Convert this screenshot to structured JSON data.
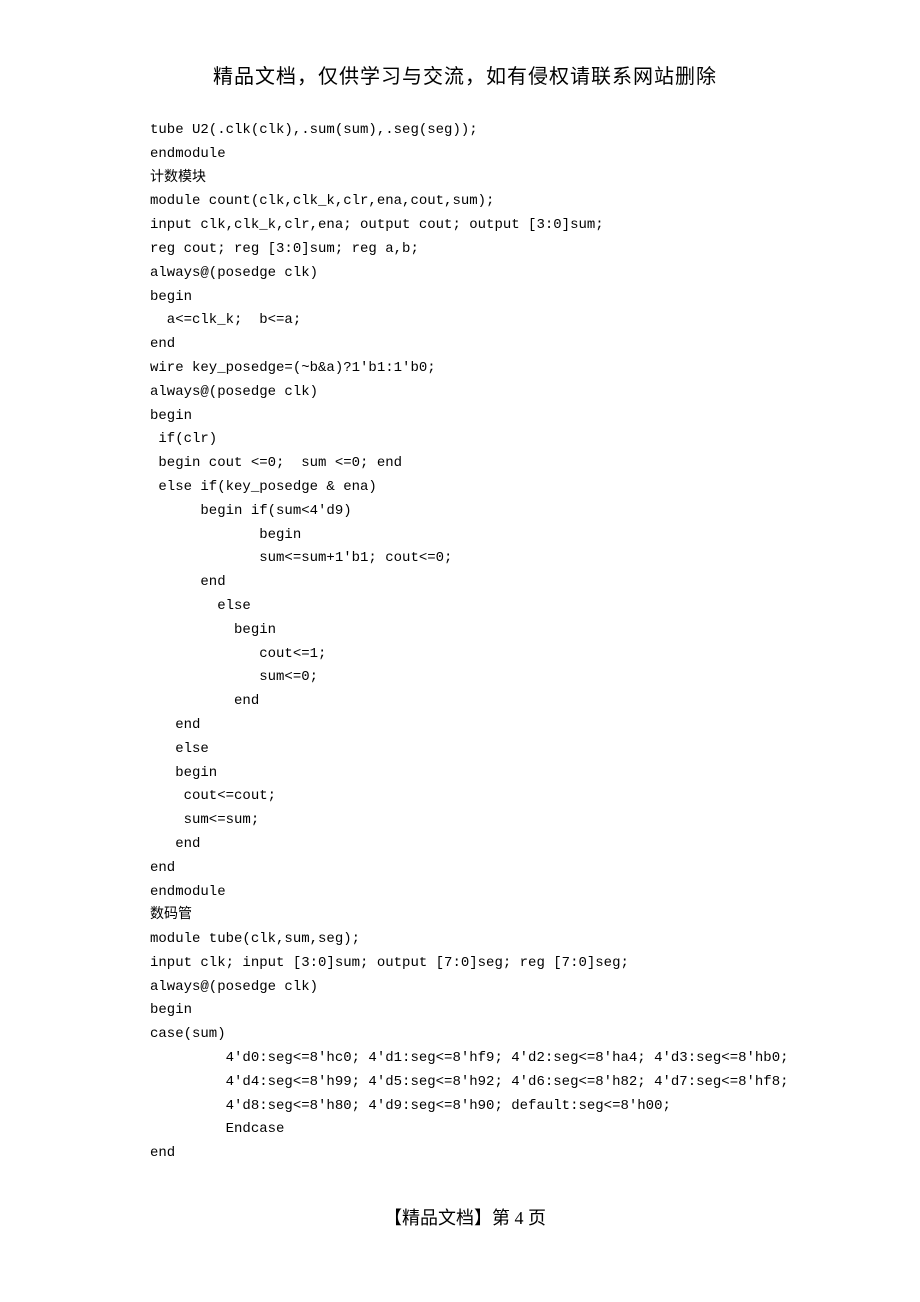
{
  "header": "精品文档，仅供学习与交流，如有侵权请联系网站删除",
  "code": {
    "l1": "tube U2(.clk(clk),.sum(sum),.seg(seg));",
    "l2": "endmodule",
    "l3": "计数模块",
    "l4": "module count(clk,clk_k,clr,ena,cout,sum);",
    "l5": "input clk,clk_k,clr,ena; output cout; output [3:0]sum;",
    "l6": "reg cout; reg [3:0]sum; reg a,b;",
    "l7": "always@(posedge clk)",
    "l8": "begin",
    "l9": "  a<=clk_k;  b<=a;",
    "l10": "end",
    "l11": "wire key_posedge=(~b&a)?1'b1:1'b0;",
    "l12": "always@(posedge clk)",
    "l13": "begin",
    "l14": " if(clr)",
    "l15": " begin cout <=0;  sum <=0; end",
    "l16": " else if(key_posedge & ena)",
    "l17": "      begin if(sum<4'd9)",
    "l18": "             begin",
    "l19": "             sum<=sum+1'b1; cout<=0;",
    "l20": "      end",
    "l21": "        else",
    "l22": "          begin",
    "l23": "             cout<=1;",
    "l24": "             sum<=0;",
    "l25": "          end",
    "l26": "   end",
    "l27": "   else",
    "l28": "   begin",
    "l29": "    cout<=cout;",
    "l30": "    sum<=sum;",
    "l31": "   end",
    "l32": "end",
    "l33": "endmodule",
    "l34": "数码管",
    "l35": "module tube(clk,sum,seg);",
    "l36": "input clk; input [3:0]sum; output [7:0]seg; reg [7:0]seg;",
    "l37": "always@(posedge clk)",
    "l38": "begin",
    "l39": "case(sum)",
    "l40": "         4'd0:seg<=8'hc0; 4'd1:seg<=8'hf9; 4'd2:seg<=8'ha4; 4'd3:seg<=8'hb0;",
    "l41": "         4'd4:seg<=8'h99; 4'd5:seg<=8'h92; 4'd6:seg<=8'h82; 4'd7:seg<=8'hf8;",
    "l42": "         4'd8:seg<=8'h80; 4'd9:seg<=8'h90; default:seg<=8'h00;",
    "l43": "         Endcase",
    "l44": "end"
  },
  "footer": "【精品文档】第 4 页"
}
